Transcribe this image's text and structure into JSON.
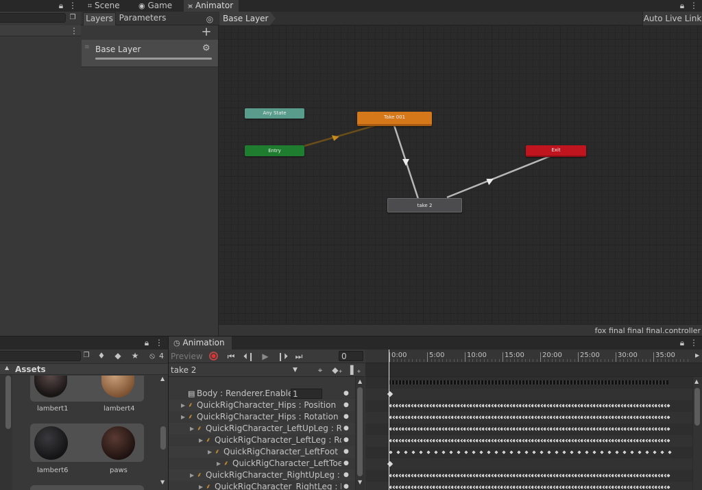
{
  "top_tabs": {
    "scene": "Scene",
    "game": "Game",
    "animator": "Animator"
  },
  "animator": {
    "tabs": {
      "layers": "Layers",
      "parameters": "Parameters"
    },
    "breadcrumb": "Base Layer",
    "auto_live_link": "Auto Live Link",
    "layer_name": "Base Layer",
    "controller_file": "fox final final final.controller",
    "nodes": {
      "any_state": "Any State",
      "entry": "Entry",
      "take001": "Take 001",
      "exit": "Exit",
      "take2": "take 2"
    },
    "colors": {
      "any_state": "#5a9c8c",
      "entry": "#1e7d2f",
      "take001": "#d4781a",
      "exit": "#c0141e",
      "take2": "#4c4c4e",
      "canvas": "#2a2a2a"
    }
  },
  "project": {
    "badge_count": "4",
    "assets_label": "Assets",
    "materials": [
      "lambert1",
      "lambert4",
      "lambert6",
      "paws"
    ]
  },
  "animation": {
    "tab": "Animation",
    "preview": "Preview",
    "frame": "0",
    "clip": "take 2",
    "ticks": [
      "0:00",
      "5:00",
      "10:00",
      "15:00",
      "20:00",
      "25:00",
      "30:00",
      "35:00"
    ],
    "properties": [
      {
        "label": "Body : Renderer.Enabled",
        "value": "1",
        "indent": 0
      },
      {
        "label": "QuickRigCharacter_Hips : Position",
        "indent": 0
      },
      {
        "label": "QuickRigCharacter_Hips : Rotation",
        "indent": 0
      },
      {
        "label": "QuickRigCharacter_LeftUpLeg : Rotation",
        "indent": 1
      },
      {
        "label": "QuickRigCharacter_LeftLeg : Rotation",
        "indent": 2
      },
      {
        "label": "QuickRigCharacter_LeftFoot : Rotation",
        "indent": 3
      },
      {
        "label": "QuickRigCharacter_LeftToeBase",
        "indent": 4
      },
      {
        "label": "QuickRigCharacter_RightUpLeg : Rotation",
        "indent": 1
      },
      {
        "label": "QuickRigCharacter_RightLeg : Rotation",
        "indent": 2
      }
    ]
  }
}
